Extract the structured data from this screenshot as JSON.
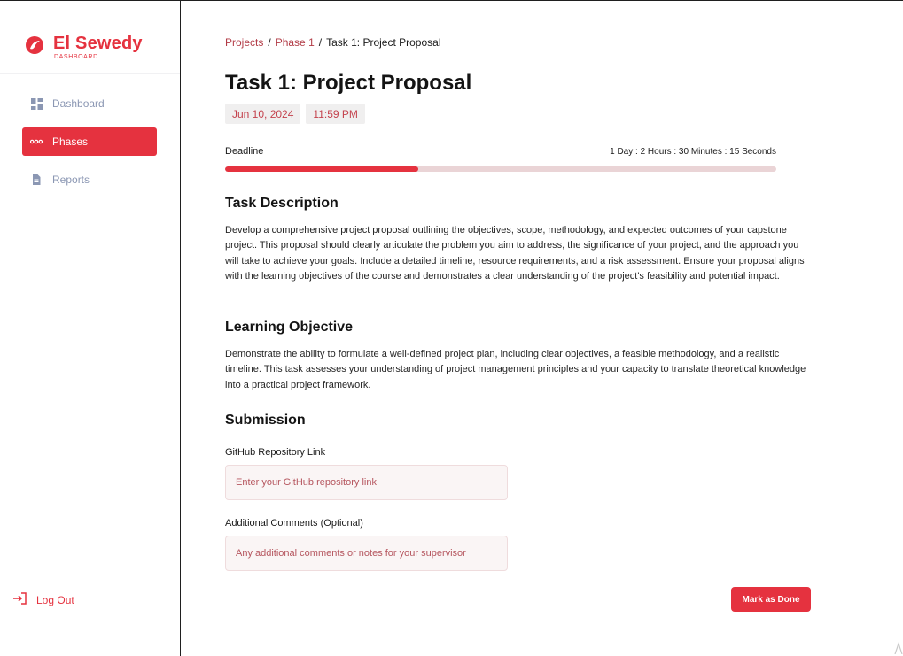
{
  "brand": {
    "name": "El Sewedy",
    "subtitle": "DASHBOARD",
    "color": "#e5323f"
  },
  "sidebar": {
    "items": [
      {
        "label": "Dashboard",
        "icon": "grid-icon",
        "active": false
      },
      {
        "label": "Phases",
        "icon": "dots-icon",
        "active": true
      },
      {
        "label": "Reports",
        "icon": "document-icon",
        "active": false
      }
    ],
    "logout": {
      "label": "Log Out",
      "icon": "logout-icon"
    }
  },
  "breadcrumb": {
    "items": [
      "Projects",
      "Phase 1",
      "Task 1: Project Proposal"
    ],
    "separator": "/"
  },
  "task": {
    "title": "Task 1: Project Proposal",
    "date": "Jun 10, 2024",
    "time": "11:59 PM",
    "deadline_label": "Deadline",
    "countdown": "1 Day : 2 Hours : 30 Minutes : 15 Seconds",
    "progress_percent": 35
  },
  "description": {
    "title": "Task Description",
    "text": "Develop a comprehensive project proposal outlining the objectives, scope, methodology, and expected outcomes of your capstone project. This proposal should clearly articulate the problem you aim to address, the significance of your project, and the approach you will take to achieve your goals. Include a detailed timeline, resource requirements, and a risk assessment. Ensure your proposal aligns with the learning objectives of the course and demonstrates a clear understanding of the project's feasibility and potential impact."
  },
  "objective": {
    "title": "Learning Objective",
    "text": "Demonstrate the ability to formulate a well-defined project plan, including clear objectives, a feasible methodology, and a realistic timeline. This task assesses your understanding of project management principles and your capacity to translate theoretical knowledge into a practical project framework."
  },
  "submission": {
    "title": "Submission",
    "github_label": "GitHub Repository Link",
    "github_value": "",
    "github_placeholder": "Enter your GitHub repository link",
    "comments_label": "Additional Comments (Optional)",
    "comments_value": "",
    "comments_placeholder": "Any additional comments or notes for your supervisor",
    "button_label": "Mark as Done"
  }
}
